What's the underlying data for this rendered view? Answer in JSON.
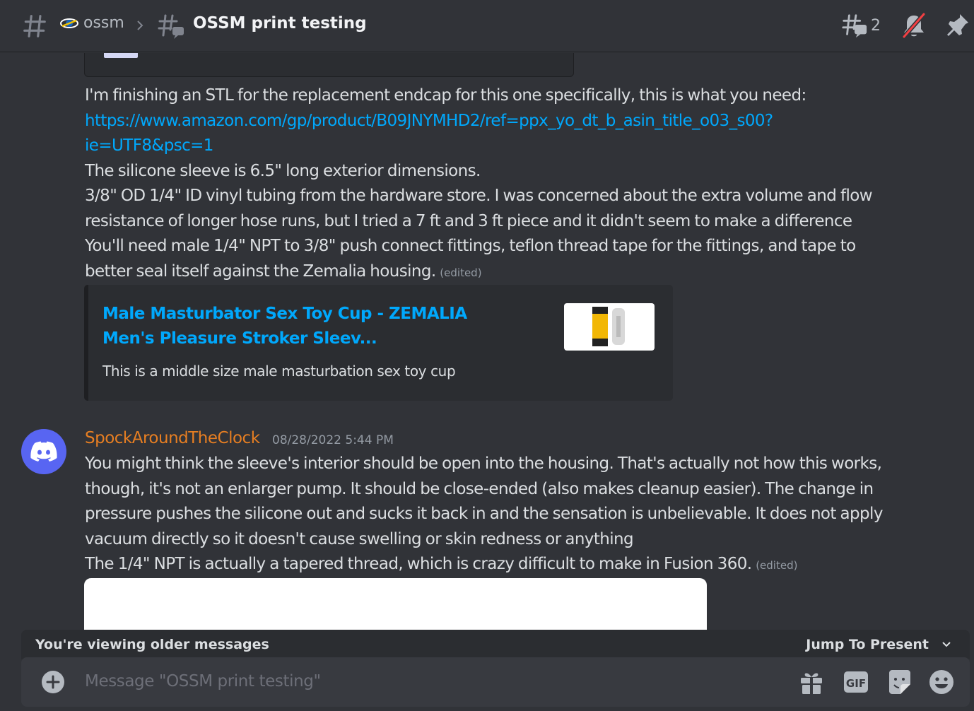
{
  "header": {
    "server_name": "ossm",
    "channel_title": "OSSM print testing",
    "thread_count": "2"
  },
  "message1": {
    "lines": [
      "I'm finishing an STL for the replacement endcap  for this one specifically, this is what you need:",
      "The silicone sleeve is 6.5\" long exterior dimensions.",
      "3/8\" OD 1/4\" ID vinyl tubing from the hardware store.  I was concerned about the extra volume and flow",
      "resistance of longer hose runs, but I tried a 7 ft and 3 ft piece and it didn't seem to make a difference",
      "You'll need male 1/4\" NPT to 3/8\" push connect fittings, teflon thread tape for the fittings, and tape to",
      "better seal itself against the Zemalia housing."
    ],
    "link_line1": "https://www.amazon.com/gp/product/B09JNYMHD2/ref=ppx_yo_dt_b_asin_title_o03_s00?",
    "link_line2": "ie=UTF8&psc=1",
    "edited": "(edited)",
    "embed": {
      "title": "Male Masturbator Sex Toy Cup - ZEMALIA Men's Pleasure Stroker Sleev...",
      "description": "This is a middle size male masturbation sex toy cup"
    }
  },
  "message2": {
    "username": "SpockAroundTheClock",
    "timestamp": "08/28/2022 5:44 PM",
    "lines": [
      "You might think the sleeve's interior should be open into the housing.  That's actually not how this works,",
      "though, it's not an enlarger pump.  It should be close-ended (also makes cleanup easier).  The change in",
      "pressure pushes the silicone out and sucks it back in and the sensation is unbelievable.   It does not apply",
      "vacuum directly so it doesn't cause swelling or skin redness or anything",
      "The 1/4\" NPT is actually a tapered thread, which is crazy difficult to make in Fusion 360."
    ],
    "edited": "(edited)"
  },
  "older_bar": {
    "label": "You're viewing older messages",
    "jump_label": "Jump To Present"
  },
  "composer": {
    "placeholder": "Message \"OSSM print testing\""
  },
  "colors": {
    "background": "#313338",
    "link": "#00a8fc",
    "username": "#e67e22",
    "avatar": "#5865f2"
  }
}
